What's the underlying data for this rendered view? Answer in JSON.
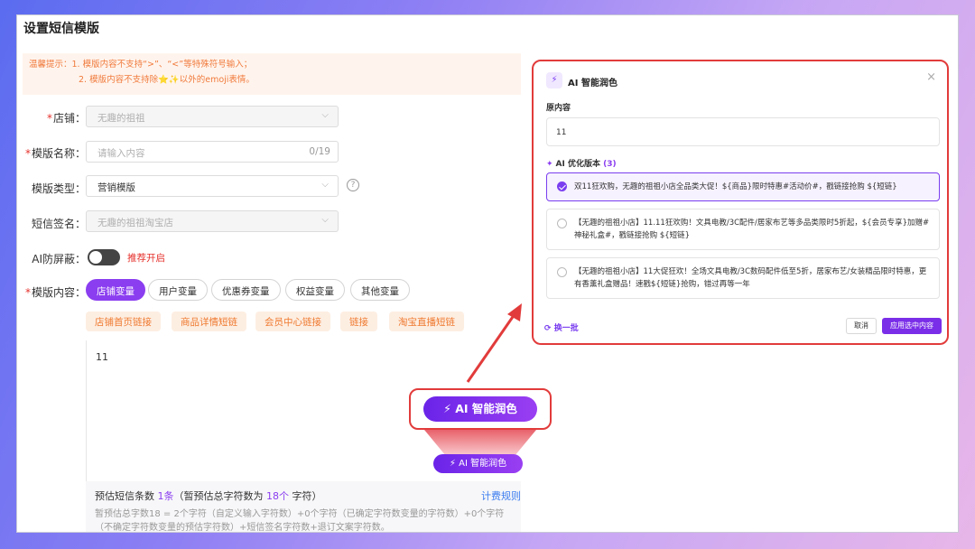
{
  "page": {
    "title": "设置短信模版"
  },
  "tip": {
    "line1": "温馨提示：1. 模版内容不支持“>”、“<”等特殊符号输入；",
    "line2": "2. 模版内容不支持除⭐✨以外的emoji表情。"
  },
  "form": {
    "shop": {
      "label": "店铺：",
      "value": "无趣的祖祖"
    },
    "name": {
      "label": "模版名称：",
      "placeholder": "请输入内容",
      "counter": "0/19"
    },
    "type": {
      "label": "模版类型：",
      "value": "营销模版"
    },
    "sign": {
      "label": "短信签名：",
      "value": "无趣的祖祖淘宝店"
    },
    "anti_block": {
      "label": "AI防屏蔽：",
      "hint": "推荐开启"
    },
    "content": {
      "label": "模版内容："
    }
  },
  "var_tabs": [
    "店铺变量",
    "用户变量",
    "优惠券变量",
    "权益变量",
    "其他变量"
  ],
  "var_tags": [
    "店铺首页链接",
    "商品详情短链",
    "会员中心链接",
    "链接",
    "淘宝直播短链"
  ],
  "editor": {
    "text": "11"
  },
  "ai_button": {
    "label": "AI 智能润色"
  },
  "stats": {
    "prefix": "预估短信条数 ",
    "count": "1条",
    "mid": "（暂预估总字符数为 ",
    "chars": "18个",
    "suffix": " 字符）",
    "detail1": "暂预估总字数18 = 2个字符（自定义输入字符数）+0个字符（已确定字符数变量的字符数）+0个字符",
    "detail2": "（不确定字符数变量的预估字符数）+短信签名字符数+退订文案字符数。",
    "rules_link": "计费规则"
  },
  "panel": {
    "title": "AI 智能润色",
    "original_label": "原内容",
    "original_value": "11",
    "optimized_label": "AI 优化版本",
    "optimized_count": "(3)",
    "options": [
      "双11狂欢购，无趣的祖祖小店全品类大促！${商品}限时特惠#活动价#，戳链接抢购 ${短链}",
      "【无趣的祖祖小店】11.11狂欢购！文具电教/3C配件/居家布艺等多品类限时5折起，${会员专享}加赠#神秘礼盒#，戳链接抢购 ${短链}",
      "【无趣的祖祖小店】11大促狂欢！全场文具电教/3C数码配件低至5折，居家布艺/女装精品限时特惠，更有香薰礼盒赠品！速戳${短链}抢购，错过再等一年"
    ],
    "refresh": "换一批",
    "cancel": "取消",
    "apply": "应用选中内容"
  },
  "colors": {
    "accent": "#8b3ef0",
    "highlight": "#e23b3b",
    "tag": "#ef7a30"
  }
}
